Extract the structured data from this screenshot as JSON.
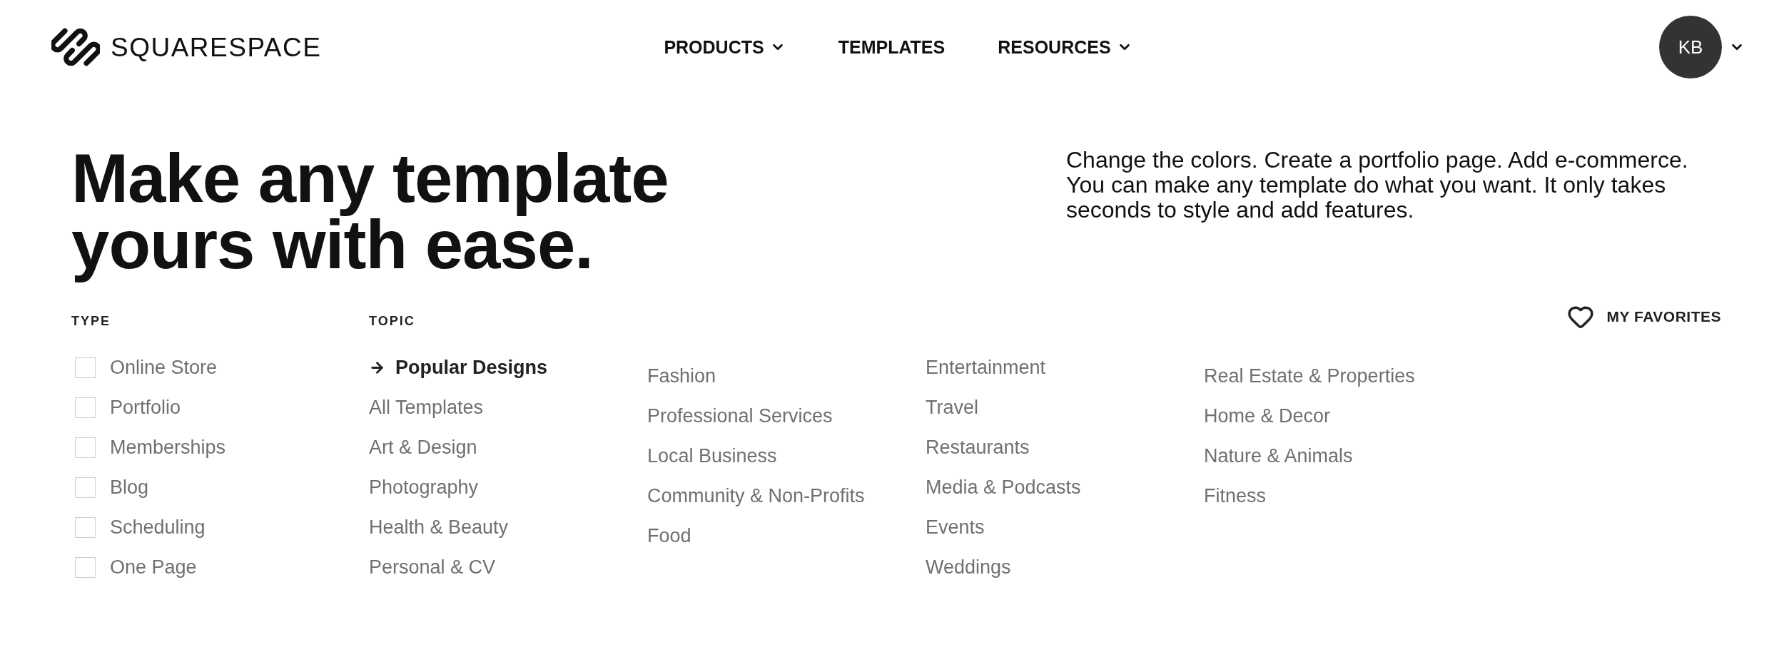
{
  "header": {
    "logo": {
      "wordmark": "SQUARESPACE"
    },
    "nav": [
      {
        "label": "PRODUCTS",
        "dropdown": true
      },
      {
        "label": "TEMPLATES",
        "dropdown": false
      },
      {
        "label": "RESOURCES",
        "dropdown": true
      }
    ],
    "account": {
      "initials": "KB",
      "dropdown": true
    }
  },
  "hero": {
    "title": "Make any template yours with ease.",
    "description": "Change the colors. Create a portfolio page. Add e-commerce. You can make any template do what you want. It only takes seconds to style and add features."
  },
  "filters": {
    "type": {
      "label": "TYPE",
      "options": [
        {
          "label": "Online Store",
          "checked": false
        },
        {
          "label": "Portfolio",
          "checked": false
        },
        {
          "label": "Memberships",
          "checked": false
        },
        {
          "label": "Blog",
          "checked": false
        },
        {
          "label": "Scheduling",
          "checked": false
        },
        {
          "label": "One Page",
          "checked": false
        }
      ]
    },
    "topic": {
      "label": "TOPIC",
      "columns": [
        [
          {
            "label": "Popular Designs",
            "selected": true
          },
          {
            "label": "All Templates",
            "selected": false
          },
          {
            "label": "Art & Design",
            "selected": false
          },
          {
            "label": "Photography",
            "selected": false
          },
          {
            "label": "Health & Beauty",
            "selected": false
          },
          {
            "label": "Personal & CV",
            "selected": false
          }
        ],
        [
          {
            "label": "Fashion",
            "selected": false
          },
          {
            "label": "Professional Services",
            "selected": false
          },
          {
            "label": "Local Business",
            "selected": false
          },
          {
            "label": "Community & Non-Profits",
            "selected": false
          },
          {
            "label": "Food",
            "selected": false
          }
        ],
        [
          {
            "label": "Entertainment",
            "selected": false
          },
          {
            "label": "Travel",
            "selected": false
          },
          {
            "label": "Restaurants",
            "selected": false
          },
          {
            "label": "Media & Podcasts",
            "selected": false
          },
          {
            "label": "Events",
            "selected": false
          },
          {
            "label": "Weddings",
            "selected": false
          }
        ],
        [
          {
            "label": "Real Estate & Properties",
            "selected": false
          },
          {
            "label": "Home & Decor",
            "selected": false
          },
          {
            "label": "Nature & Animals",
            "selected": false
          },
          {
            "label": "Fitness",
            "selected": false
          }
        ]
      ]
    },
    "favorites": {
      "label": "MY FAVORITES"
    }
  }
}
